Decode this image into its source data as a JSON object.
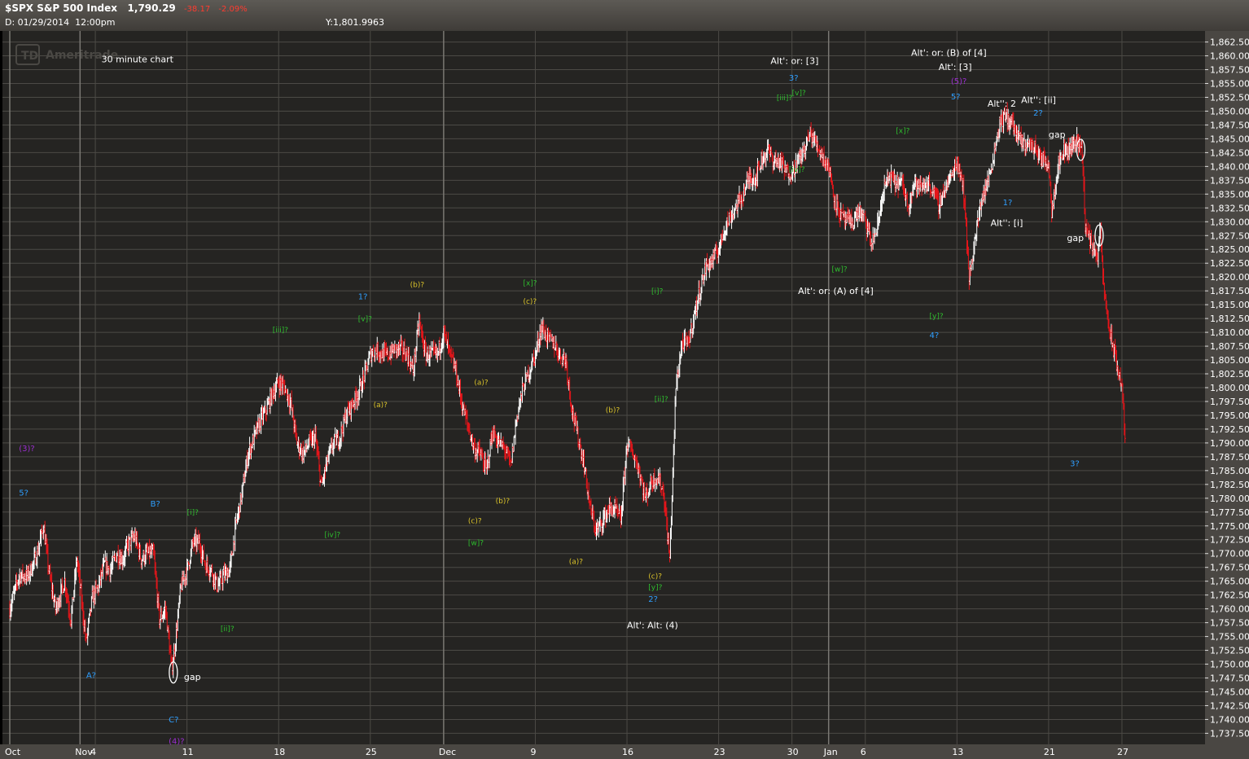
{
  "header": {
    "symbol": "$SPX S&P 500 Index",
    "last": "1,790.29",
    "change": "-38.17",
    "change_pct": "-2.09%",
    "date_label": "D: 01/29/2014",
    "time_label": "12:00pm",
    "y_cursor": "Y:1,801.9963"
  },
  "watermark": "TD Ameritrade",
  "chart_note": "30 minute chart",
  "colors": {
    "background": "#252422",
    "up": "#ffffff",
    "down": "#e8151a",
    "grid": "#4c4a46",
    "wave_blue": "#2f9fff",
    "wave_green": "#2ebd2e",
    "wave_yellow": "#d9c22a",
    "wave_purple": "#9b2fd0",
    "note_white": "#ffffff"
  },
  "chart_data": {
    "type": "candlestick",
    "interval": "30 minute",
    "ylim": [
      1735.5,
      1864.5
    ],
    "y_ticks": [
      "1,862.50",
      "1,860.00",
      "1,857.50",
      "1,855.00",
      "1,852.50",
      "1,850.00",
      "1,847.50",
      "1,845.00",
      "1,842.50",
      "1,840.00",
      "1,837.50",
      "1,835.00",
      "1,832.50",
      "1,830.00",
      "1,827.50",
      "1,825.00",
      "1,822.50",
      "1,820.00",
      "1,817.50",
      "1,815.00",
      "1,812.50",
      "1,810.00",
      "1,807.50",
      "1,805.00",
      "1,802.50",
      "1,800.00",
      "1,797.50",
      "1,795.00",
      "1,792.50",
      "1,790.00",
      "1,787.50",
      "1,785.00",
      "1,782.50",
      "1,780.00",
      "1,777.50",
      "1,775.00",
      "1,772.50",
      "1,770.00",
      "1,767.50",
      "1,765.00",
      "1,762.50",
      "1,760.00",
      "1,757.50",
      "1,755.00",
      "1,752.50",
      "1,750.00",
      "1,747.50",
      "1,745.00",
      "1,742.50",
      "1,740.00",
      "1,737.50"
    ],
    "x_ticks": [
      {
        "label": "Oct",
        "x": 0
      },
      {
        "label": "Nov",
        "x": 23
      },
      {
        "label": "4",
        "x": 28
      },
      {
        "label": "11",
        "x": 58
      },
      {
        "label": "18",
        "x": 88
      },
      {
        "label": "25",
        "x": 118
      },
      {
        "label": "Dec",
        "x": 142
      },
      {
        "label": "9",
        "x": 172
      },
      {
        "label": "16",
        "x": 202
      },
      {
        "label": "23",
        "x": 232
      },
      {
        "label": "30",
        "x": 256
      },
      {
        "label": "Jan",
        "x": 268
      },
      {
        "label": "6",
        "x": 280
      },
      {
        "label": "13",
        "x": 310
      },
      {
        "label": "21",
        "x": 340
      },
      {
        "label": "27",
        "x": 364
      }
    ],
    "x_range": [
      0,
      376
    ],
    "close_path": [
      [
        0,
        1760
      ],
      [
        3,
        1766
      ],
      [
        6,
        1766
      ],
      [
        9,
        1770
      ],
      [
        11,
        1775
      ],
      [
        13,
        1766
      ],
      [
        15,
        1760
      ],
      [
        18,
        1765
      ],
      [
        20,
        1758
      ],
      [
        22,
        1769
      ],
      [
        25,
        1754
      ],
      [
        27,
        1762
      ],
      [
        29,
        1764
      ],
      [
        31,
        1768
      ],
      [
        33,
        1767
      ],
      [
        35,
        1770
      ],
      [
        37,
        1769
      ],
      [
        39,
        1772
      ],
      [
        41,
        1773
      ],
      [
        43,
        1769
      ],
      [
        45,
        1770
      ],
      [
        47,
        1770
      ],
      [
        49,
        1758
      ],
      [
        51,
        1760
      ],
      [
        53,
        1749
      ],
      [
        54,
        1753
      ],
      [
        56,
        1764
      ],
      [
        58,
        1767
      ],
      [
        60,
        1772
      ],
      [
        62,
        1772
      ],
      [
        64,
        1768
      ],
      [
        66,
        1767
      ],
      [
        68,
        1764
      ],
      [
        70,
        1766
      ],
      [
        72,
        1767
      ],
      [
        74,
        1775
      ],
      [
        76,
        1781
      ],
      [
        78,
        1788
      ],
      [
        80,
        1791
      ],
      [
        82,
        1794
      ],
      [
        84,
        1796
      ],
      [
        86,
        1799
      ],
      [
        88,
        1801
      ],
      [
        90,
        1800
      ],
      [
        92,
        1797
      ],
      [
        94,
        1790
      ],
      [
        96,
        1788
      ],
      [
        98,
        1790
      ],
      [
        100,
        1791
      ],
      [
        102,
        1782
      ],
      [
        104,
        1787
      ],
      [
        106,
        1790
      ],
      [
        108,
        1791
      ],
      [
        110,
        1795
      ],
      [
        112,
        1797
      ],
      [
        114,
        1799
      ],
      [
        116,
        1802
      ],
      [
        118,
        1806
      ],
      [
        120,
        1807
      ],
      [
        122,
        1806
      ],
      [
        124,
        1806
      ],
      [
        126,
        1807
      ],
      [
        128,
        1807
      ],
      [
        130,
        1806
      ],
      [
        132,
        1803
      ],
      [
        134,
        1812
      ],
      [
        136,
        1806
      ],
      [
        138,
        1806
      ],
      [
        140,
        1806
      ],
      [
        142,
        1810
      ],
      [
        144,
        1806
      ],
      [
        146,
        1803
      ],
      [
        148,
        1797
      ],
      [
        150,
        1793
      ],
      [
        152,
        1789
      ],
      [
        154,
        1788
      ],
      [
        156,
        1785
      ],
      [
        158,
        1792
      ],
      [
        160,
        1790
      ],
      [
        162,
        1789
      ],
      [
        164,
        1786
      ],
      [
        166,
        1795
      ],
      [
        168,
        1800
      ],
      [
        170,
        1803
      ],
      [
        172,
        1806
      ],
      [
        174,
        1811
      ],
      [
        176,
        1809
      ],
      [
        178,
        1808
      ],
      [
        180,
        1806
      ],
      [
        182,
        1805
      ],
      [
        184,
        1796
      ],
      [
        186,
        1791
      ],
      [
        188,
        1786
      ],
      [
        190,
        1778
      ],
      [
        192,
        1774
      ],
      [
        194,
        1776
      ],
      [
        196,
        1778
      ],
      [
        198,
        1778
      ],
      [
        200,
        1776
      ],
      [
        202,
        1790
      ],
      [
        204,
        1788
      ],
      [
        206,
        1785
      ],
      [
        208,
        1780
      ],
      [
        210,
        1783
      ],
      [
        212,
        1784
      ],
      [
        214,
        1781
      ],
      [
        216,
        1769
      ],
      [
        218,
        1800
      ],
      [
        220,
        1808
      ],
      [
        222,
        1808
      ],
      [
        224,
        1813
      ],
      [
        226,
        1818
      ],
      [
        228,
        1822
      ],
      [
        230,
        1823
      ],
      [
        232,
        1825
      ],
      [
        234,
        1829
      ],
      [
        236,
        1831
      ],
      [
        238,
        1833
      ],
      [
        240,
        1835
      ],
      [
        242,
        1838
      ],
      [
        244,
        1838
      ],
      [
        246,
        1841
      ],
      [
        248,
        1843
      ],
      [
        250,
        1841
      ],
      [
        252,
        1841
      ],
      [
        254,
        1839
      ],
      [
        256,
        1839
      ],
      [
        258,
        1841
      ],
      [
        260,
        1843
      ],
      [
        262,
        1846
      ],
      [
        264,
        1844
      ],
      [
        266,
        1842
      ],
      [
        268,
        1840
      ],
      [
        270,
        1834
      ],
      [
        272,
        1831
      ],
      [
        274,
        1830
      ],
      [
        276,
        1830
      ],
      [
        278,
        1832
      ],
      [
        280,
        1830
      ],
      [
        282,
        1826
      ],
      [
        284,
        1829
      ],
      [
        286,
        1836
      ],
      [
        288,
        1838
      ],
      [
        290,
        1837
      ],
      [
        292,
        1837
      ],
      [
        294,
        1833
      ],
      [
        296,
        1837
      ],
      [
        298,
        1836
      ],
      [
        300,
        1837
      ],
      [
        302,
        1836
      ],
      [
        304,
        1833
      ],
      [
        306,
        1836
      ],
      [
        308,
        1838
      ],
      [
        310,
        1841
      ],
      [
        312,
        1837
      ],
      [
        314,
        1820
      ],
      [
        316,
        1827
      ],
      [
        318,
        1834
      ],
      [
        320,
        1837
      ],
      [
        322,
        1842
      ],
      [
        324,
        1848
      ],
      [
        326,
        1849
      ],
      [
        328,
        1848
      ],
      [
        330,
        1845
      ],
      [
        332,
        1844
      ],
      [
        334,
        1844
      ],
      [
        336,
        1843
      ],
      [
        338,
        1841
      ],
      [
        340,
        1841
      ],
      [
        341,
        1832
      ],
      [
        343,
        1840
      ],
      [
        345,
        1843
      ],
      [
        347,
        1843
      ],
      [
        349,
        1845
      ],
      [
        351,
        1843
      ],
      [
        352,
        1829
      ],
      [
        354,
        1826
      ],
      [
        356,
        1824
      ],
      [
        357,
        1828
      ],
      [
        358,
        1818
      ],
      [
        360,
        1810
      ],
      [
        362,
        1805
      ],
      [
        364,
        1800
      ],
      [
        365,
        1791
      ]
    ],
    "wave_labels": [
      {
        "text": "(3)?",
        "x": 3,
        "y": 1788.5,
        "color": "purple"
      },
      {
        "text": "5?",
        "x": 3,
        "y": 1780.5,
        "color": "blue"
      },
      {
        "text": "A?",
        "x": 25,
        "y": 1747.5,
        "color": "blue"
      },
      {
        "text": "B?",
        "x": 46,
        "y": 1778.5,
        "color": "blue"
      },
      {
        "text": "C?",
        "x": 52,
        "y": 1739.5,
        "color": "blue"
      },
      {
        "text": "(4)?",
        "x": 52,
        "y": 1735.6,
        "color": "purple"
      },
      {
        "text": "gap",
        "x": 57,
        "y": 1747.1,
        "color": "white"
      },
      {
        "text": "[i]?",
        "x": 58,
        "y": 1777.0,
        "color": "green"
      },
      {
        "text": "[ii]?",
        "x": 69,
        "y": 1756.0,
        "color": "green"
      },
      {
        "text": "30 minute chart",
        "x": 30,
        "y": 1858.8,
        "color": "white"
      },
      {
        "text": "[iii]?",
        "x": 86,
        "y": 1810.0,
        "color": "green"
      },
      {
        "text": "[iv]?",
        "x": 103,
        "y": 1773.0,
        "color": "green"
      },
      {
        "text": "1?",
        "x": 114,
        "y": 1816.0,
        "color": "blue"
      },
      {
        "text": "[v]?",
        "x": 114,
        "y": 1812.0,
        "color": "green"
      },
      {
        "text": "(a)?",
        "x": 119,
        "y": 1796.5,
        "color": "yellow"
      },
      {
        "text": "(b)?",
        "x": 131,
        "y": 1818.2,
        "color": "yellow"
      },
      {
        "text": "(a)?",
        "x": 152,
        "y": 1800.5,
        "color": "yellow"
      },
      {
        "text": "(b)?",
        "x": 159,
        "y": 1779.1,
        "color": "yellow"
      },
      {
        "text": "(c)?",
        "x": 150,
        "y": 1775.5,
        "color": "yellow"
      },
      {
        "text": "[w]?",
        "x": 150,
        "y": 1771.5,
        "color": "green"
      },
      {
        "text": "[x]?",
        "x": 168,
        "y": 1818.5,
        "color": "green"
      },
      {
        "text": "(c)?",
        "x": 168,
        "y": 1815.2,
        "color": "yellow"
      },
      {
        "text": "(b)?",
        "x": 195,
        "y": 1795.5,
        "color": "yellow"
      },
      {
        "text": "(a)?",
        "x": 183,
        "y": 1768.1,
        "color": "yellow"
      },
      {
        "text": "(c)?",
        "x": 209,
        "y": 1765.5,
        "color": "yellow"
      },
      {
        "text": "[y]?",
        "x": 209,
        "y": 1763.5,
        "color": "green"
      },
      {
        "text": "2?",
        "x": 209,
        "y": 1761.3,
        "color": "blue"
      },
      {
        "text": "Alt': Alt: (4)",
        "x": 202,
        "y": 1756.5,
        "color": "white"
      },
      {
        "text": "[i]?",
        "x": 210,
        "y": 1817.0,
        "color": "green"
      },
      {
        "text": "[ii]?",
        "x": 211,
        "y": 1797.5,
        "color": "green"
      },
      {
        "text": "[iii]?",
        "x": 251,
        "y": 1852.0,
        "color": "green"
      },
      {
        "text": "[v]?",
        "x": 256,
        "y": 1852.9,
        "color": "green"
      },
      {
        "text": "3?",
        "x": 255,
        "y": 1855.5,
        "color": "blue"
      },
      {
        "text": "Alt': or: [3]",
        "x": 249,
        "y": 1858.5,
        "color": "white"
      },
      {
        "text": "[iv]?",
        "x": 255,
        "y": 1839.0,
        "color": "green"
      },
      {
        "text": "Alt': or: (A) of [4]",
        "x": 258,
        "y": 1816.9,
        "color": "white"
      },
      {
        "text": "[w]?",
        "x": 269,
        "y": 1821.0,
        "color": "green"
      },
      {
        "text": "[x]?",
        "x": 290,
        "y": 1846.0,
        "color": "green"
      },
      {
        "text": "[y]?",
        "x": 301,
        "y": 1812.5,
        "color": "green"
      },
      {
        "text": "4?",
        "x": 301,
        "y": 1809.0,
        "color": "blue"
      },
      {
        "text": "Alt': or: (B) of [4]",
        "x": 295,
        "y": 1860.0,
        "color": "white"
      },
      {
        "text": "Alt': [3]",
        "x": 304,
        "y": 1857.4,
        "color": "white"
      },
      {
        "text": "(5)?",
        "x": 308,
        "y": 1854.9,
        "color": "purple"
      },
      {
        "text": "5?",
        "x": 308,
        "y": 1852.1,
        "color": "blue"
      },
      {
        "text": "Alt'': 2",
        "x": 320,
        "y": 1850.8,
        "color": "white"
      },
      {
        "text": "Alt'': [ii]",
        "x": 331,
        "y": 1851.5,
        "color": "white"
      },
      {
        "text": "2?",
        "x": 335,
        "y": 1849.2,
        "color": "blue"
      },
      {
        "text": "gap",
        "x": 340,
        "y": 1845.2,
        "color": "white"
      },
      {
        "text": "1?",
        "x": 325,
        "y": 1833.0,
        "color": "blue"
      },
      {
        "text": "Alt'': [i]",
        "x": 321,
        "y": 1829.2,
        "color": "white"
      },
      {
        "text": "gap",
        "x": 346,
        "y": 1826.5,
        "color": "white"
      },
      {
        "text": "3?",
        "x": 347,
        "y": 1785.8,
        "color": "blue"
      }
    ]
  }
}
